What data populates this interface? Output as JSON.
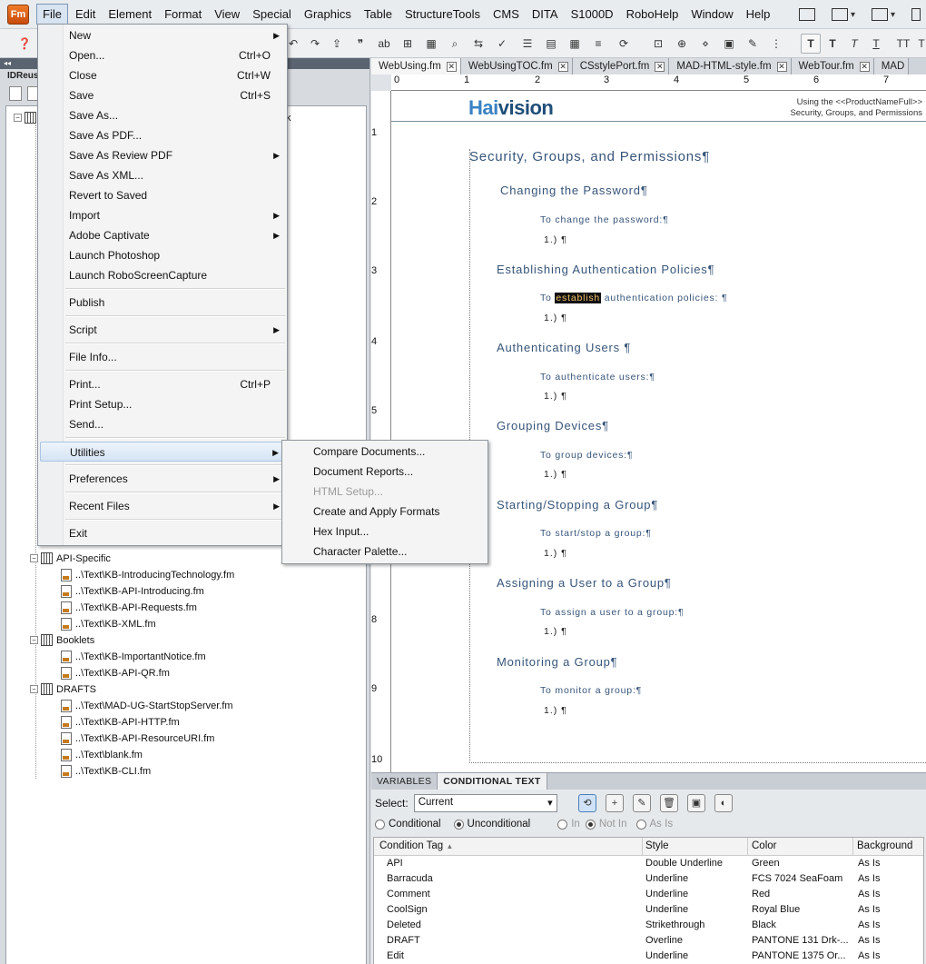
{
  "app": {
    "logo_text": "Fm"
  },
  "menubar": {
    "items": [
      "File",
      "Edit",
      "Element",
      "Format",
      "View",
      "Special",
      "Graphics",
      "Table",
      "StructureTools",
      "CMS",
      "DITA",
      "S1000D",
      "RoboHelp",
      "Window",
      "Help"
    ]
  },
  "left_panel": {
    "title": "IDReus"
  },
  "tree": {
    "partial_text": "k",
    "items": [
      {
        "label": "API-Specific",
        "type": "folder"
      },
      {
        "label": "..\\Text\\KB-IntroducingTechnology.fm",
        "type": "file"
      },
      {
        "label": "..\\Text\\KB-API-Introducing.fm",
        "type": "file"
      },
      {
        "label": "..\\Text\\KB-API-Requests.fm",
        "type": "file"
      },
      {
        "label": "..\\Text\\KB-XML.fm",
        "type": "file"
      },
      {
        "label": "Booklets",
        "type": "folder"
      },
      {
        "label": "..\\Text\\KB-ImportantNotice.fm",
        "type": "file"
      },
      {
        "label": "..\\Text\\KB-API-QR.fm",
        "type": "file"
      },
      {
        "label": "DRAFTS",
        "type": "folder"
      },
      {
        "label": "..\\Text\\MAD-UG-StartStopServer.fm",
        "type": "file"
      },
      {
        "label": "..\\Text\\KB-API-HTTP.fm",
        "type": "file"
      },
      {
        "label": "..\\Text\\KB-API-ResourceURI.fm",
        "type": "file"
      },
      {
        "label": "..\\Text\\blank.fm",
        "type": "file"
      },
      {
        "label": "..\\Text\\KB-CLI.fm",
        "type": "file"
      }
    ]
  },
  "doc_tabs": [
    "WebUsing.fm",
    "WebUsingTOC.fm",
    "CSstylePort.fm",
    "MAD-HTML-style.fm",
    "WebTour.fm",
    "MAD"
  ],
  "ruler": {
    "h": [
      "0",
      "1",
      "2",
      "3",
      "4",
      "5",
      "6",
      "7"
    ],
    "v": [
      "1",
      "2",
      "3",
      "4",
      "5",
      "8",
      "9",
      "10"
    ]
  },
  "document": {
    "logo_a": "Hai",
    "logo_b": "vision",
    "header_line1": "Using the <<ProductNameFull>>",
    "header_line2": "Security, Groups, and Permissions",
    "title": "Security, Groups, and Permissions¶",
    "step": "1.) ¶",
    "sections": [
      {
        "heading": "Changing the Password¶",
        "intro": "To change the password:¶"
      },
      {
        "heading": "Establishing Authentication Policies¶",
        "intro_pre": "To ",
        "intro_hl": "establish",
        "intro_post": " authentication policies: ¶"
      },
      {
        "heading": "Authenticating Users ¶",
        "intro": "To authenticate users:¶"
      },
      {
        "heading": "Grouping Devices¶",
        "intro": "To group devices:¶"
      },
      {
        "heading": "Starting/Stopping a Group¶",
        "intro": "To start/stop a group:¶"
      },
      {
        "heading": "Assigning a User to a Group¶",
        "intro": "To assign a user to a group:¶"
      },
      {
        "heading": "Monitoring a Group¶",
        "intro": "To monitor a group:¶"
      }
    ]
  },
  "bottom_panel": {
    "tabs": [
      "VARIABLES",
      "CONDITIONAL TEXT"
    ],
    "select_label": "Select:",
    "select_value": "Current",
    "radio_conditional": "Conditional",
    "radio_unconditional": "Unconditional",
    "radio_in": "In",
    "radio_not_in": "Not In",
    "radio_as_is": "As Is",
    "columns": [
      "Condition Tag",
      "Style",
      "Color",
      "Background"
    ],
    "rows": [
      [
        "API",
        "Double Underline",
        "Green",
        "As Is"
      ],
      [
        "Barracuda",
        "Underline",
        "FCS 7024 SeaFoam",
        "As Is"
      ],
      [
        "Comment",
        "Underline",
        "Red",
        "As Is"
      ],
      [
        "CoolSign",
        "Underline",
        "Royal Blue",
        "As Is"
      ],
      [
        "Deleted",
        "Strikethrough",
        "Black",
        "As Is"
      ],
      [
        "DRAFT",
        "Overline",
        "PANTONE 131 Drk-...",
        "As Is"
      ],
      [
        "Edit",
        "Underline",
        "PANTONE 1375 Or...",
        "As Is"
      ]
    ]
  },
  "file_menu": {
    "items": [
      {
        "label": "New",
        "shortcut": "",
        "arrow": true
      },
      {
        "label": "Open...",
        "shortcut": "Ctrl+O"
      },
      {
        "label": "Close",
        "shortcut": "Ctrl+W"
      },
      {
        "label": "Save",
        "shortcut": "Ctrl+S"
      },
      {
        "label": "Save As...",
        "shortcut": ""
      },
      {
        "label": "Save As PDF...",
        "shortcut": ""
      },
      {
        "label": "Save As Review PDF",
        "shortcut": "",
        "arrow": true
      },
      {
        "label": "Save As XML...",
        "shortcut": ""
      },
      {
        "label": "Revert to Saved",
        "shortcut": ""
      },
      {
        "label": "Import",
        "shortcut": "",
        "arrow": true
      },
      {
        "label": "Adobe Captivate",
        "shortcut": "",
        "arrow": true
      },
      {
        "label": "Launch Photoshop",
        "shortcut": ""
      },
      {
        "label": "Launch RoboScreenCapture",
        "shortcut": ""
      },
      {
        "label": "Publish",
        "shortcut": ""
      },
      {
        "label": "Script",
        "shortcut": "",
        "arrow": true
      },
      {
        "label": "File Info...",
        "shortcut": ""
      },
      {
        "label": "Print...",
        "shortcut": "Ctrl+P"
      },
      {
        "label": "Print Setup...",
        "shortcut": ""
      },
      {
        "label": "Send...",
        "shortcut": ""
      },
      {
        "label": "Utilities",
        "shortcut": "",
        "arrow": true
      },
      {
        "label": "Preferences",
        "shortcut": "",
        "arrow": true
      },
      {
        "label": "Recent Files",
        "shortcut": "",
        "arrow": true
      },
      {
        "label": "Exit",
        "shortcut": ""
      }
    ]
  },
  "utilities_submenu": {
    "items": [
      {
        "label": "Compare Documents...",
        "disabled": false
      },
      {
        "label": "Document Reports...",
        "disabled": false
      },
      {
        "label": "HTML Setup...",
        "disabled": true
      },
      {
        "label": "Create and Apply Formats",
        "disabled": false
      },
      {
        "label": "Hex Input...",
        "disabled": false
      },
      {
        "label": "Character Palette...",
        "disabled": false
      }
    ]
  }
}
